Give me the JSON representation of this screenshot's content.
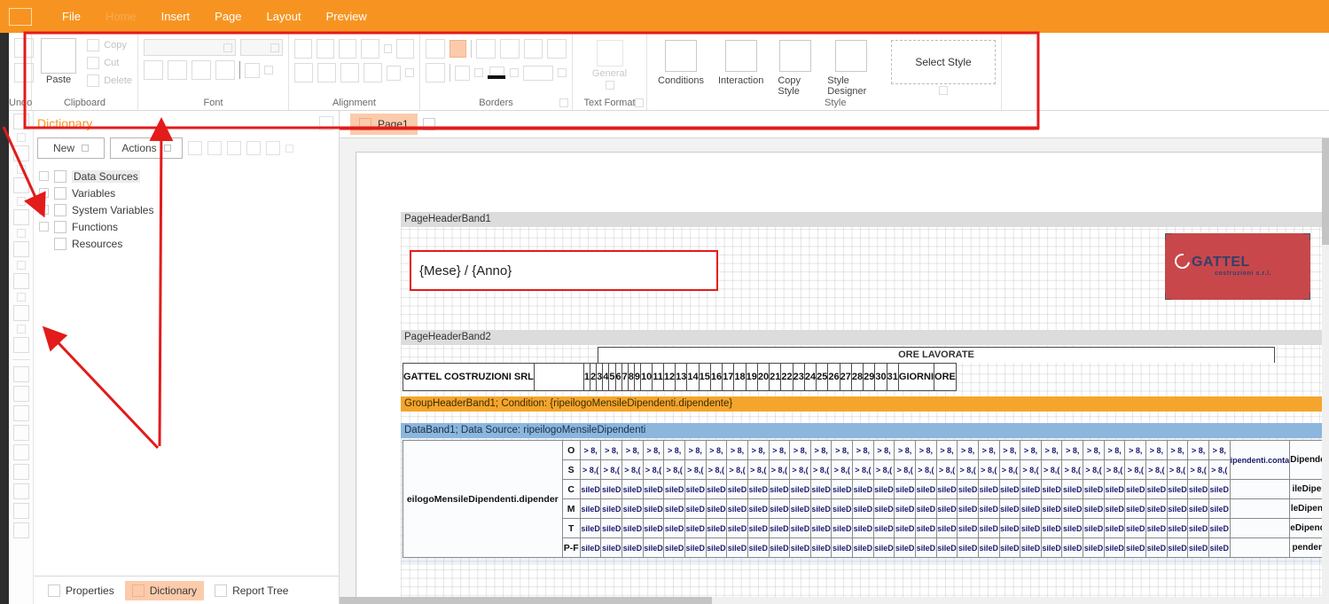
{
  "menubar": {
    "items": [
      {
        "label": "File",
        "dim": false
      },
      {
        "label": "Home",
        "dim": true
      },
      {
        "label": "Insert",
        "dim": false
      },
      {
        "label": "Page",
        "dim": false
      },
      {
        "label": "Layout",
        "dim": false
      },
      {
        "label": "Preview",
        "dim": false
      }
    ],
    "accent_color": "#f79421"
  },
  "ribbon": {
    "groups": [
      {
        "label": "Undo"
      },
      {
        "label": "Clipboard"
      },
      {
        "label": "Font"
      },
      {
        "label": "Alignment"
      },
      {
        "label": "Borders"
      },
      {
        "label": "Text Format"
      },
      {
        "label": "Style"
      }
    ],
    "clipboard": {
      "paste_label": "Paste",
      "copy_label": "Copy",
      "cut_label": "Cut",
      "delete_label": "Delete"
    },
    "text_format": {
      "general_label": "General"
    },
    "style": {
      "conditions_label": "Conditions",
      "interaction_label": "Interaction",
      "copy_style_label": "Copy Style",
      "style_designer_label": "Style Designer",
      "select_style_label": "Select Style"
    }
  },
  "dictionary": {
    "title": "Dictionary",
    "new_button": "New",
    "actions_button": "Actions",
    "tree": [
      {
        "label": "Data Sources",
        "selected": true,
        "indent": false
      },
      {
        "label": "Variables",
        "selected": false,
        "indent": false
      },
      {
        "label": "System Variables",
        "selected": false,
        "indent": false
      },
      {
        "label": "Functions",
        "selected": false,
        "indent": false
      },
      {
        "label": "Resources",
        "selected": false,
        "indent": true
      }
    ],
    "tabs": [
      {
        "label": "Properties",
        "active": false
      },
      {
        "label": "Dictionary",
        "active": true
      },
      {
        "label": "Report Tree",
        "active": false
      }
    ]
  },
  "designer": {
    "page_tabs": [
      {
        "label": "Page1",
        "active": true
      }
    ],
    "bands": {
      "page_header_1": "PageHeaderBand1",
      "page_header_2": "PageHeaderBand2",
      "group_header_1": "GroupHeaderBand1; Condition: {ripeilogoMensileDipendenti.dipendente}",
      "data_band_1": "DataBand1; Data Source: ripeilogoMensileDipendenti"
    },
    "title_textbox": "{Mese} / {Anno}",
    "logo": {
      "name": "GATTEL",
      "subtitle": "costruzioni s.r.l.",
      "slab_color": "#c8474b",
      "text_color": "#33406b"
    },
    "header_table": {
      "company": "GATTEL COSTRUZIONI SRL",
      "ore_lavorate": "ORE LAVORATE",
      "days": [
        "1",
        "2",
        "3",
        "4",
        "5",
        "6",
        "7",
        "8",
        "9",
        "10",
        "11",
        "12",
        "13",
        "14",
        "15",
        "16",
        "17",
        "18",
        "19",
        "20",
        "21",
        "22",
        "23",
        "24",
        "25",
        "26",
        "27",
        "28",
        "29",
        "30",
        "31"
      ],
      "giorni": "GIORNI",
      "ore": "ORE"
    },
    "data_band": {
      "dipendente_cell": "eilogoMensileDipendenti.dipender",
      "row_labels": [
        "O",
        "S",
        "C",
        "M",
        "T",
        "P-F"
      ],
      "cell_text_o": "> 8,",
      "cell_text_s": "> 8,(",
      "cell_text_other": "sileD",
      "tail_top_1": "ipendenti.conta",
      "tail_top_2": "Dipendenti.cont",
      "tail_rows": [
        "ileDipendenti.c",
        "leDipendenti.co",
        "eDipendenti.cor",
        "pendenti.conta"
      ]
    }
  },
  "annotations": {
    "color": "#e31b1b",
    "count": 3
  }
}
